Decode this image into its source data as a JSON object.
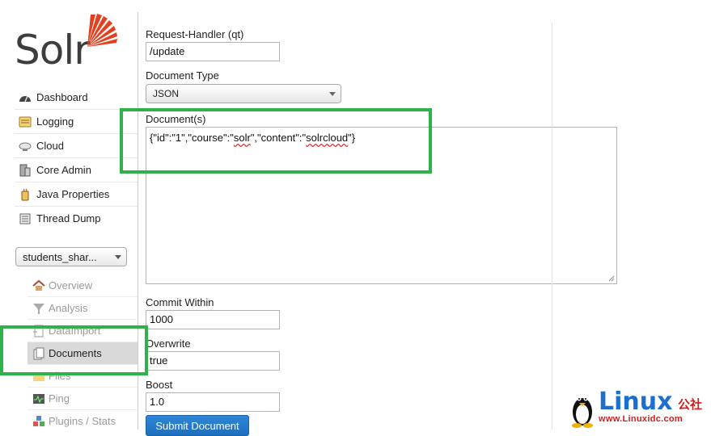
{
  "logo": {
    "text": "Solr"
  },
  "main_nav": [
    {
      "label": "Dashboard",
      "icon": "dashboard-icon"
    },
    {
      "label": "Logging",
      "icon": "logging-icon"
    },
    {
      "label": "Cloud",
      "icon": "cloud-icon"
    },
    {
      "label": "Core Admin",
      "icon": "core-admin-icon"
    },
    {
      "label": "Java Properties",
      "icon": "java-icon"
    },
    {
      "label": "Thread Dump",
      "icon": "thread-dump-icon"
    }
  ],
  "core_selector": {
    "value": "students_shar..."
  },
  "core_nav": [
    {
      "label": "Overview",
      "icon": "home-icon"
    },
    {
      "label": "Analysis",
      "icon": "funnel-icon"
    },
    {
      "label": "DataImport",
      "icon": "dataimport-icon"
    },
    {
      "label": "Documents",
      "icon": "documents-icon",
      "active": true
    },
    {
      "label": "Files",
      "icon": "folder-icon"
    },
    {
      "label": "Ping",
      "icon": "ping-icon"
    },
    {
      "label": "Plugins / Stats",
      "icon": "plugins-icon"
    }
  ],
  "form": {
    "request_handler_label": "Request-Handler (qt)",
    "request_handler_value": "/update",
    "document_type_label": "Document Type",
    "document_type_value": "JSON",
    "documents_label": "Document(s)",
    "documents": {
      "p1": "{\"id\":\"1\",\"course\":\"",
      "w1": "solr",
      "p2": "\",\"content\":\"",
      "w2": "solrcloud",
      "p3": "\"}"
    },
    "commit_within_label": "Commit Within",
    "commit_within_value": "1000",
    "overwrite_label": "Overwrite",
    "overwrite_value": "true",
    "boost_label": "Boost",
    "boost_value": "1.0",
    "submit_label": "Submit Document"
  },
  "watermark": {
    "title": "Linux",
    "cn": "公社",
    "url": "www.Linuxidc.com"
  },
  "colors": {
    "highlight": "#2fb14b",
    "submit": "#2277c9",
    "watermark_blue": "#1b6fd1",
    "watermark_red": "#cf2020"
  }
}
